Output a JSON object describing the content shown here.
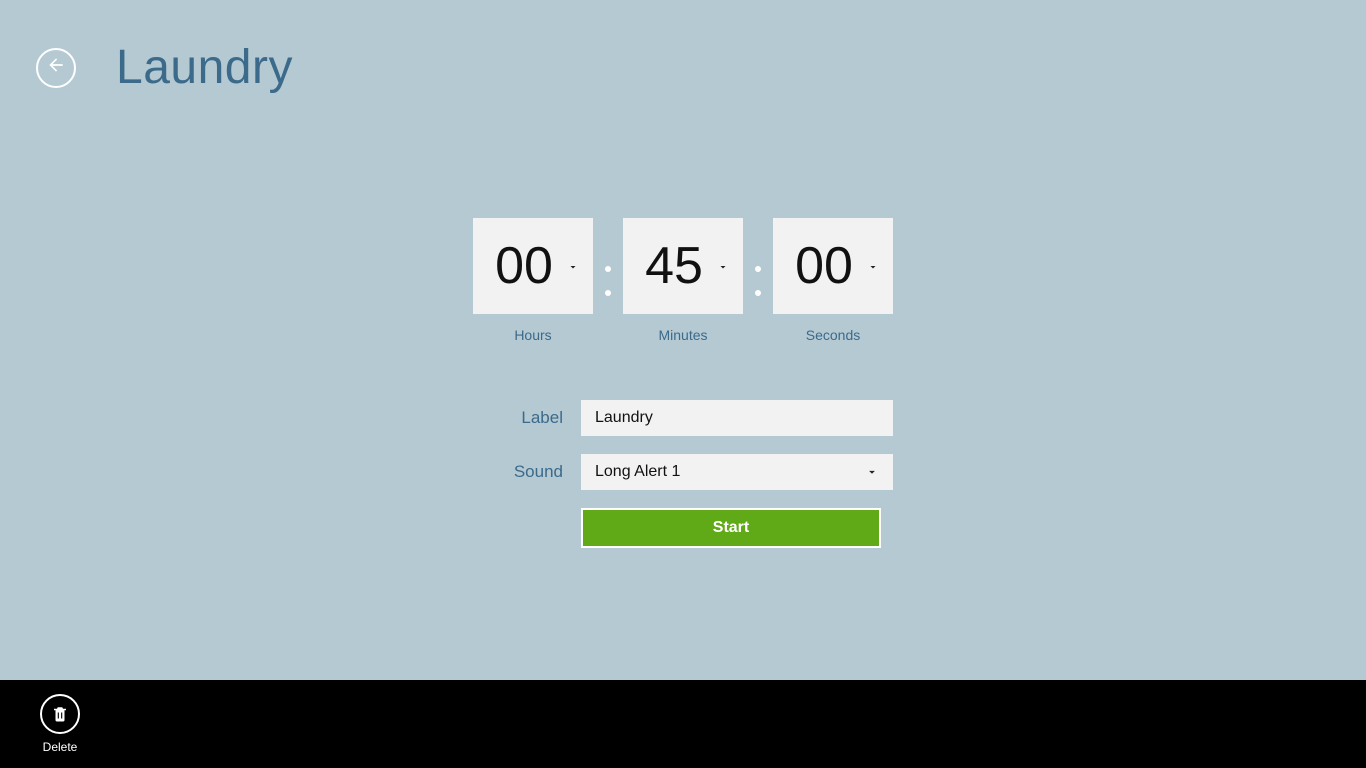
{
  "header": {
    "title": "Laundry"
  },
  "timer": {
    "hours": {
      "value": "00",
      "label": "Hours"
    },
    "minutes": {
      "value": "45",
      "label": "Minutes"
    },
    "seconds": {
      "value": "00",
      "label": "Seconds"
    }
  },
  "form": {
    "label_caption": "Label",
    "label_value": "Laundry",
    "sound_caption": "Sound",
    "sound_value": "Long Alert 1",
    "start_button": "Start"
  },
  "appbar": {
    "delete_label": "Delete"
  }
}
